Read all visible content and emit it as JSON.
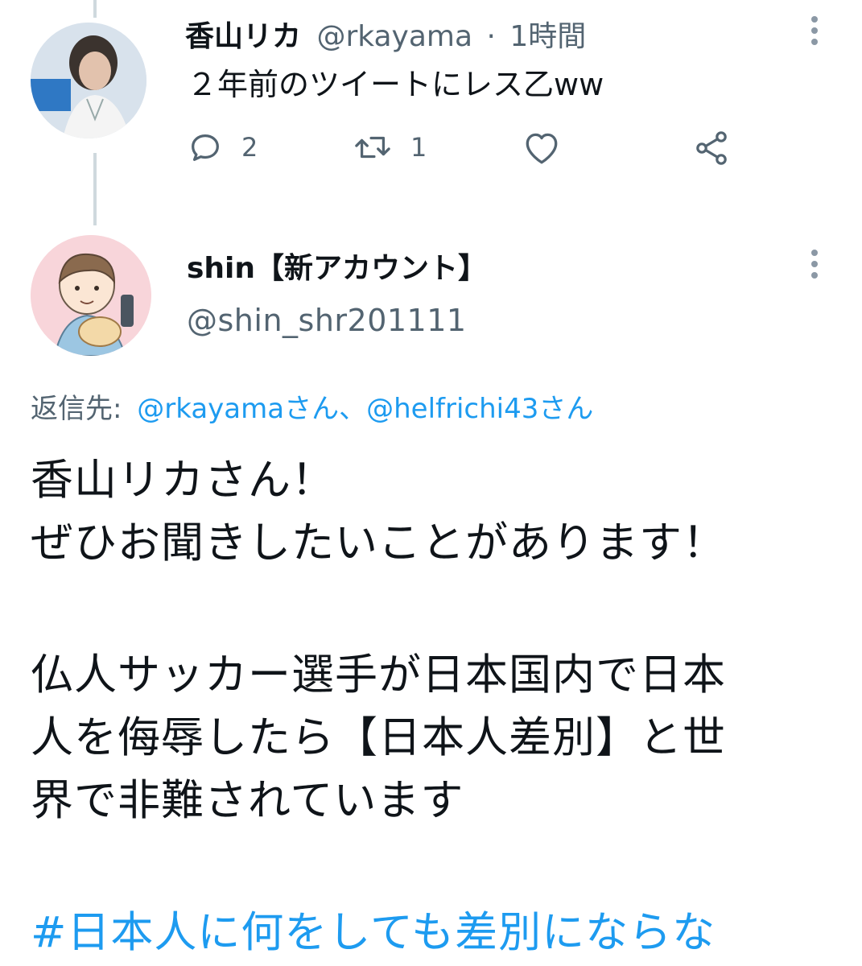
{
  "tweet1": {
    "name": "香山リカ",
    "handle": "@rkayama",
    "sep": "·",
    "time": "1時間",
    "text": "２年前のツイートにレス乙ww",
    "actions": {
      "reply_count": "2",
      "retweet_count": "1"
    },
    "icons": [
      "reply-icon",
      "retweet-icon",
      "like-icon",
      "share-icon",
      "more-icon"
    ]
  },
  "tweet2": {
    "name": "shin【新アカウント】",
    "handle": "@shin_shr201111",
    "reply_to": {
      "label": "返信先:",
      "mentions": "@rkayamaさん、@helfrichi43さん"
    },
    "body_lines": [
      "香山リカさん！",
      "ぜひお聞きしたいことがあります！",
      "",
      "仏人サッカー選手が日本国内で日本",
      "人を侮辱したら【日本人差別】と世",
      "界で非難されています",
      "",
      "#日本人に何をしても差別にならな"
    ]
  },
  "colors": {
    "accent": "#1d9bf0",
    "muted": "#536471",
    "thread_line": "#cfd9de"
  }
}
